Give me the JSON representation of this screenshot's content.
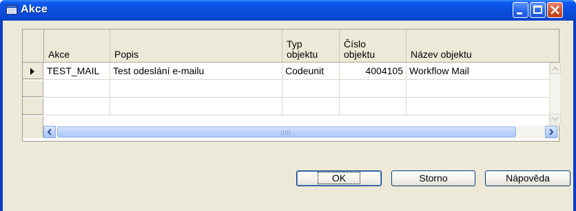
{
  "window": {
    "title": "Akce",
    "title_icon": "table-form-icon",
    "controls": [
      "minimize-icon",
      "maximize-icon",
      "close-icon"
    ]
  },
  "grid": {
    "columns": [
      {
        "label": "Akce"
      },
      {
        "label": "Popis"
      },
      {
        "label": "Typ\nobjektu"
      },
      {
        "label": "Číslo\nobjektu"
      },
      {
        "label": "Název objektu"
      }
    ],
    "rows": [
      {
        "akce": "TEST_MAIL",
        "popis": "Test odeslání e-mailu",
        "typ": "Codeunit",
        "cislo": "4004105",
        "nazev": "Workflow Mail",
        "current": true
      },
      {
        "akce": "",
        "popis": "",
        "typ": "",
        "cislo": "",
        "nazev": "",
        "current": false
      },
      {
        "akce": "",
        "popis": "",
        "typ": "",
        "cislo": "",
        "nazev": "",
        "current": false
      }
    ]
  },
  "buttons": {
    "ok": "OK",
    "storno": "Storno",
    "napoveda": "Nápověda"
  }
}
